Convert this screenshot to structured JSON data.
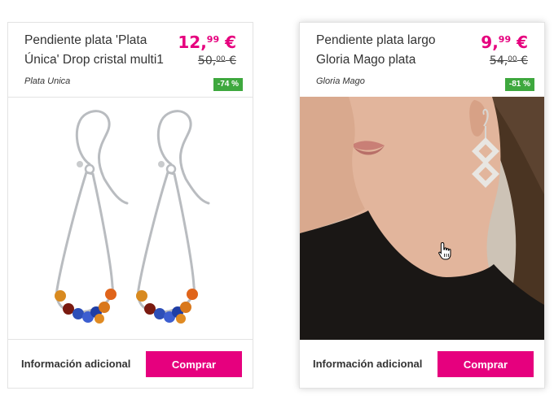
{
  "products": [
    {
      "title_line1": "Pendiente plata 'Plata",
      "title_line2": "Única' Drop cristal multi1",
      "price_int": "12,",
      "price_dec": "99",
      "price_cur": " €",
      "old_int": "50,",
      "old_dec": "00",
      "old_cur": " €",
      "brand": "Plata Unica",
      "discount": "-74 %",
      "info_label": "Información adicional",
      "buy_label": "Comprar"
    },
    {
      "title_line1": "Pendiente plata largo",
      "title_line2": "Gloria Mago plata",
      "price_int": "9,",
      "price_dec": "99",
      "price_cur": " €",
      "old_int": "54,",
      "old_dec": "00",
      "old_cur": " €",
      "brand": "Gloria Mago",
      "discount": "-81 %",
      "info_label": "Información adicional",
      "buy_label": "Comprar"
    }
  ],
  "colors": {
    "accent": "#e6007e",
    "discount_badge": "#3ea83e"
  }
}
